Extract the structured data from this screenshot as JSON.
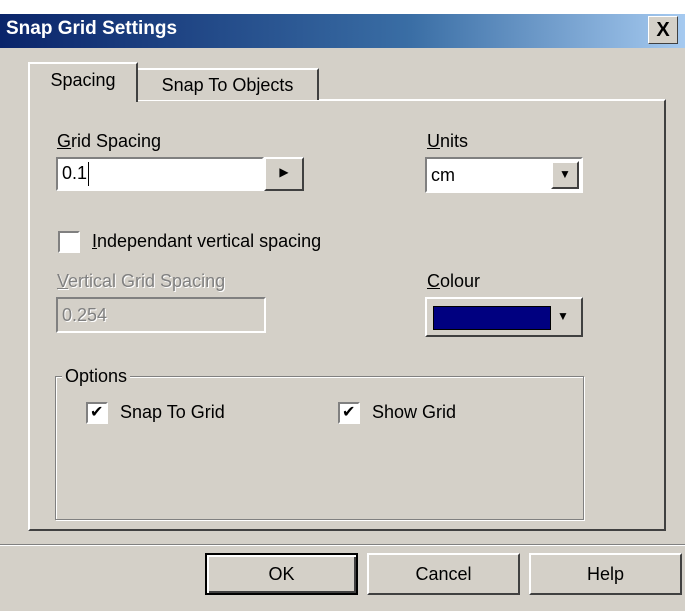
{
  "window": {
    "title": "Snap Grid Settings",
    "close_glyph": "X"
  },
  "tabs": [
    {
      "label": "Spacing",
      "active": true
    },
    {
      "label": "Snap To Objects",
      "active": false
    }
  ],
  "grid_spacing": {
    "label_mnemonic": "G",
    "label_rest": "rid Spacing",
    "value": "0.1",
    "spin_glyph": "▶"
  },
  "units": {
    "label_mnemonic": "U",
    "label_rest": "nits",
    "value": "cm",
    "dropdown_glyph": "▼"
  },
  "independent": {
    "label_mnemonic": "I",
    "label_rest": "ndependant vertical spacing",
    "checked": false
  },
  "vertical_spacing": {
    "label_mnemonic": "V",
    "label_rest": "ertical Grid Spacing",
    "value": "0.254",
    "enabled": false
  },
  "colour": {
    "label_mnemonic": "C",
    "label_rest": "olour",
    "swatch": "#000080",
    "dropdown_glyph": "▼"
  },
  "options": {
    "legend": "Options",
    "snap_to_grid": {
      "label": "Snap To Grid",
      "checked": true,
      "check_glyph": "✔"
    },
    "show_grid": {
      "label": "Show Grid",
      "checked": true,
      "check_glyph": "✔"
    }
  },
  "buttons": {
    "ok": "OK",
    "cancel": "Cancel",
    "help": "Help"
  },
  "colors": {
    "face": "#d4d0c8",
    "title_start": "#0a246a",
    "title_end": "#a6caf0"
  }
}
